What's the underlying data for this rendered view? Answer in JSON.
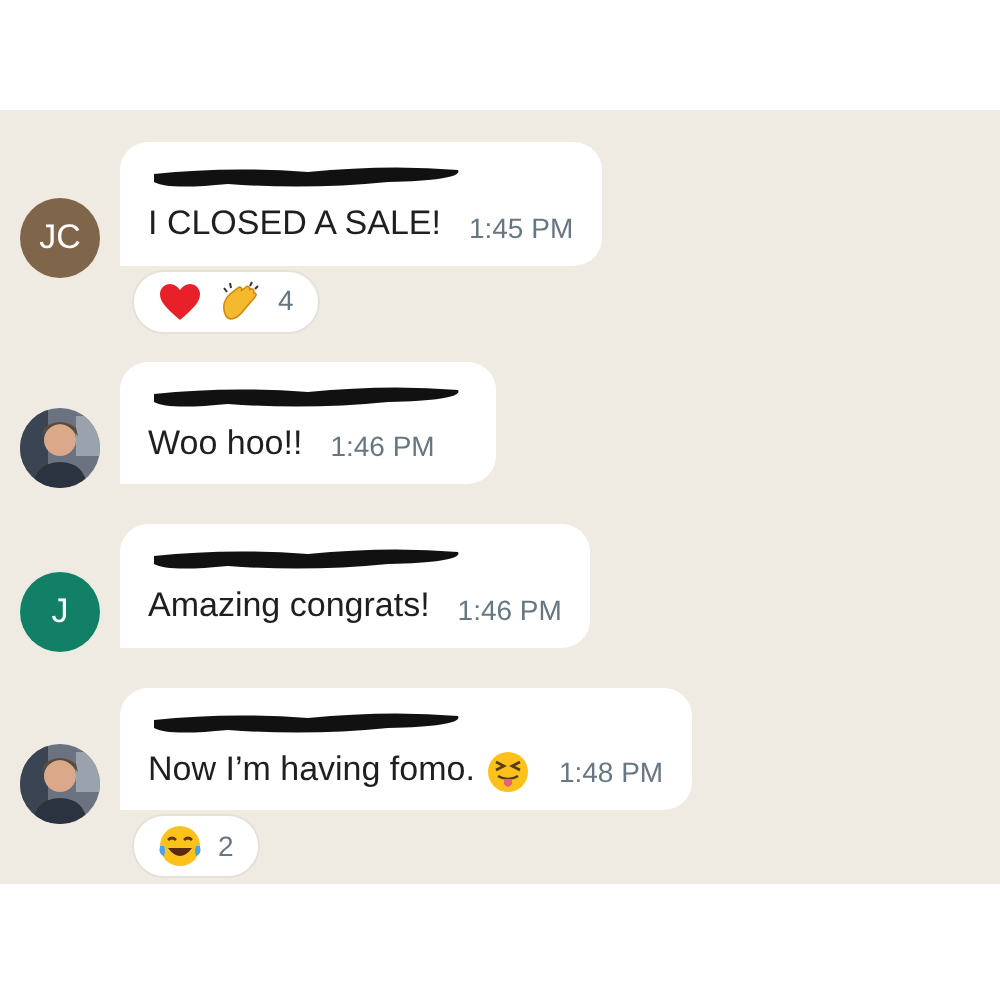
{
  "messages": [
    {
      "avatar": {
        "kind": "initials",
        "initials": "JC",
        "color": "#7f6549"
      },
      "text": "I CLOSED A SALE!",
      "time": "1:45 PM",
      "reactions": {
        "emojis": [
          {
            "kind": "heart"
          },
          {
            "kind": "clap"
          }
        ],
        "count": "4"
      }
    },
    {
      "text": "Woo hoo!!",
      "time": "1:46 PM"
    },
    {
      "avatar": {
        "kind": "initials",
        "initials": "J",
        "color": "#128067"
      },
      "text": "Amazing congrats!",
      "time": "1:46 PM"
    },
    {
      "text": "Now I’m having fomo.",
      "inline_emoji": {
        "kind": "tongue"
      },
      "time": "1:48 PM",
      "reactions": {
        "emojis": [
          {
            "kind": "laugh"
          }
        ],
        "count": "2"
      }
    }
  ]
}
